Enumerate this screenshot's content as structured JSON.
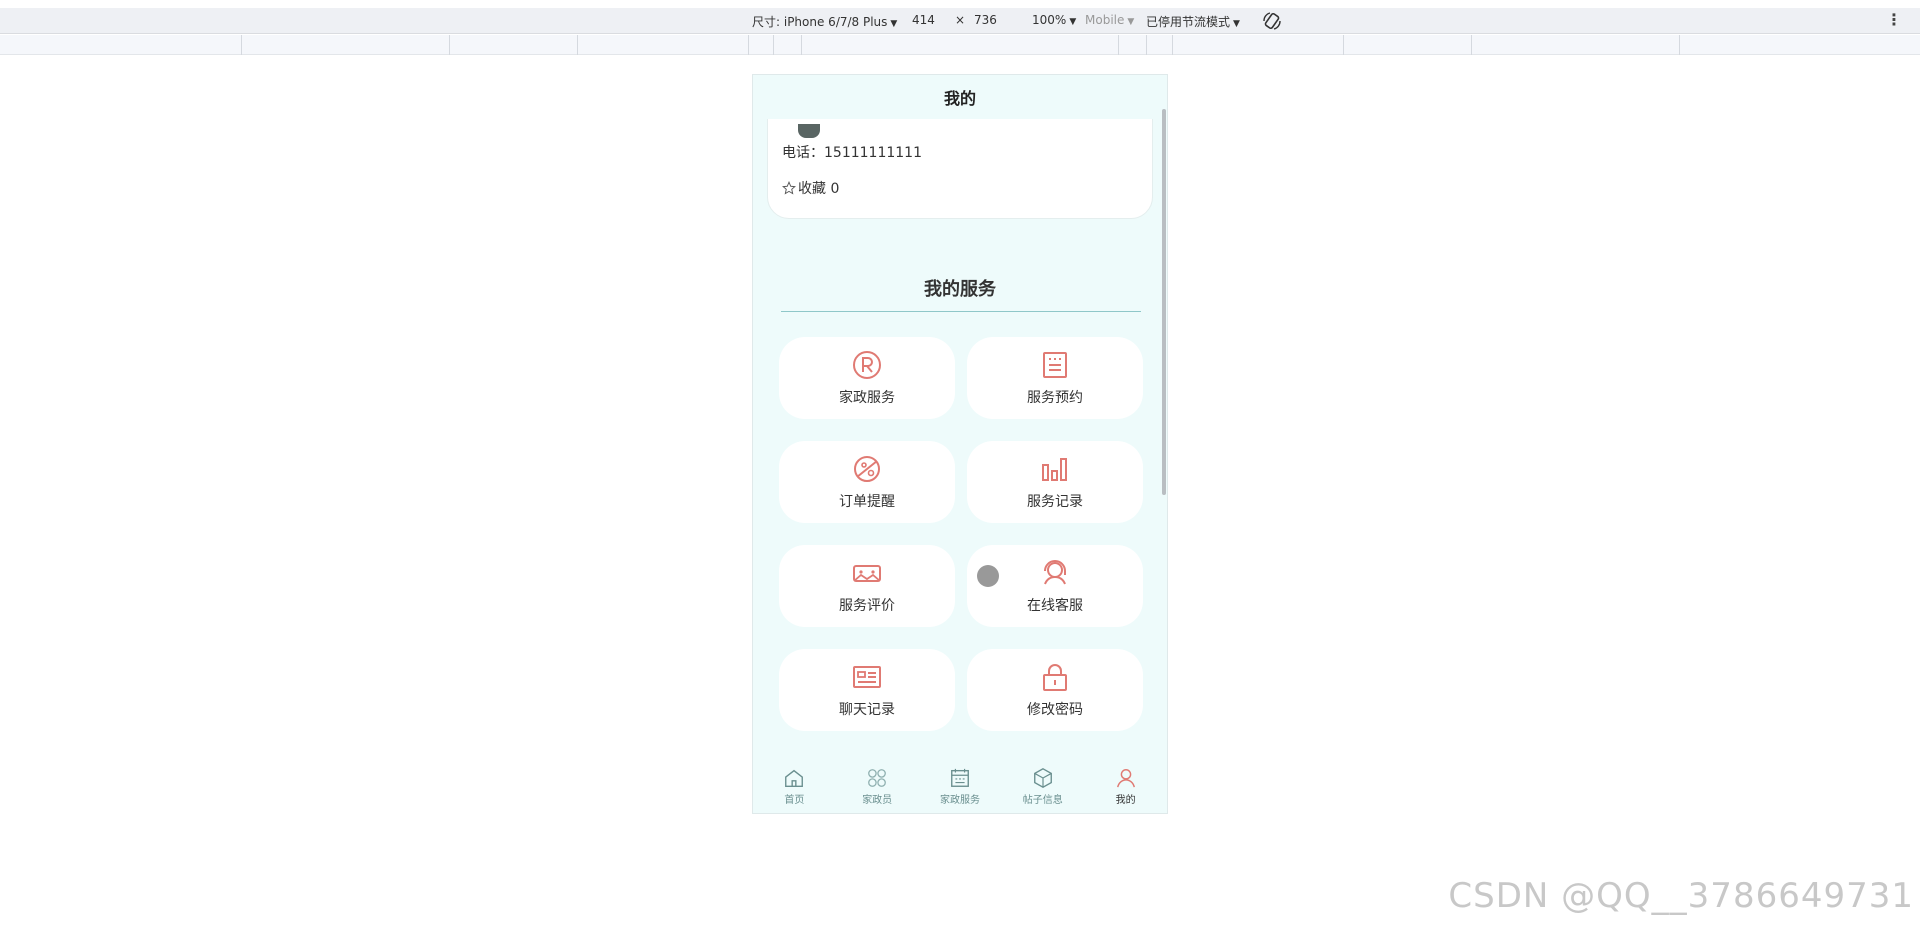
{
  "devtools": {
    "device_label": "尺寸: iPhone 6/7/8 Plus",
    "width": "414",
    "times": "×",
    "height": "736",
    "zoom": "100%",
    "mode": "Mobile",
    "throttle": "已停用节流模式"
  },
  "page": {
    "title": "我的",
    "profile": {
      "phone_label": "电话：15111111111",
      "favorites_label": "收藏 0"
    },
    "services_title": "我的服务",
    "services": [
      {
        "label": "家政服务",
        "icon": "registered-icon"
      },
      {
        "label": "服务预约",
        "icon": "list-document-icon"
      },
      {
        "label": "订单提醒",
        "icon": "planet-icon"
      },
      {
        "label": "服务记录",
        "icon": "bar-chart-icon"
      },
      {
        "label": "服务评价",
        "icon": "vr-glasses-icon"
      },
      {
        "label": "在线客服",
        "icon": "headset-icon"
      },
      {
        "label": "聊天记录",
        "icon": "id-card-icon"
      },
      {
        "label": "修改密码",
        "icon": "lock-icon"
      }
    ],
    "tabs": [
      {
        "label": "首页",
        "icon": "home-icon"
      },
      {
        "label": "家政员",
        "icon": "grid-circles-icon"
      },
      {
        "label": "家政服务",
        "icon": "calendar-icon"
      },
      {
        "label": "帖子信息",
        "icon": "cube-icon"
      },
      {
        "label": "我的",
        "icon": "user-icon"
      }
    ]
  },
  "colors": {
    "accent": "#e07a73",
    "background": "#eefbfb",
    "divider": "#8fc7c9"
  },
  "watermark": "CSDN @QQ__3786649731"
}
